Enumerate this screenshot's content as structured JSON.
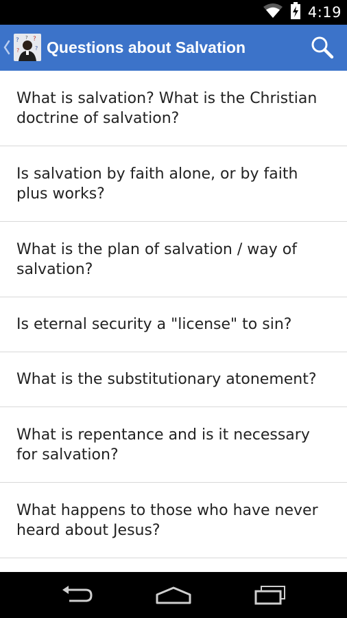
{
  "status_bar": {
    "time": "4:19",
    "icons": [
      "wifi-icon",
      "battery-charging-icon"
    ]
  },
  "action_bar": {
    "title": "Questions about Salvation",
    "icons": [
      "up-caret-icon",
      "app-logo",
      "search-icon"
    ],
    "color": "#3c73c9"
  },
  "questions": [
    "What is salvation? What is the Christian doctrine of salvation?",
    "Is salvation by faith alone, or by faith plus works?",
    "What is the plan of salvation / way of salvation?",
    "Is eternal security a \"license\" to sin?",
    "What is the substitutionary atonement?",
    "What is repentance and is it necessary for salvation?",
    "What happens to those who have never heard about Jesus?"
  ],
  "nav_bar": {
    "icons": [
      "back-icon",
      "home-icon",
      "recent-apps-icon"
    ]
  }
}
